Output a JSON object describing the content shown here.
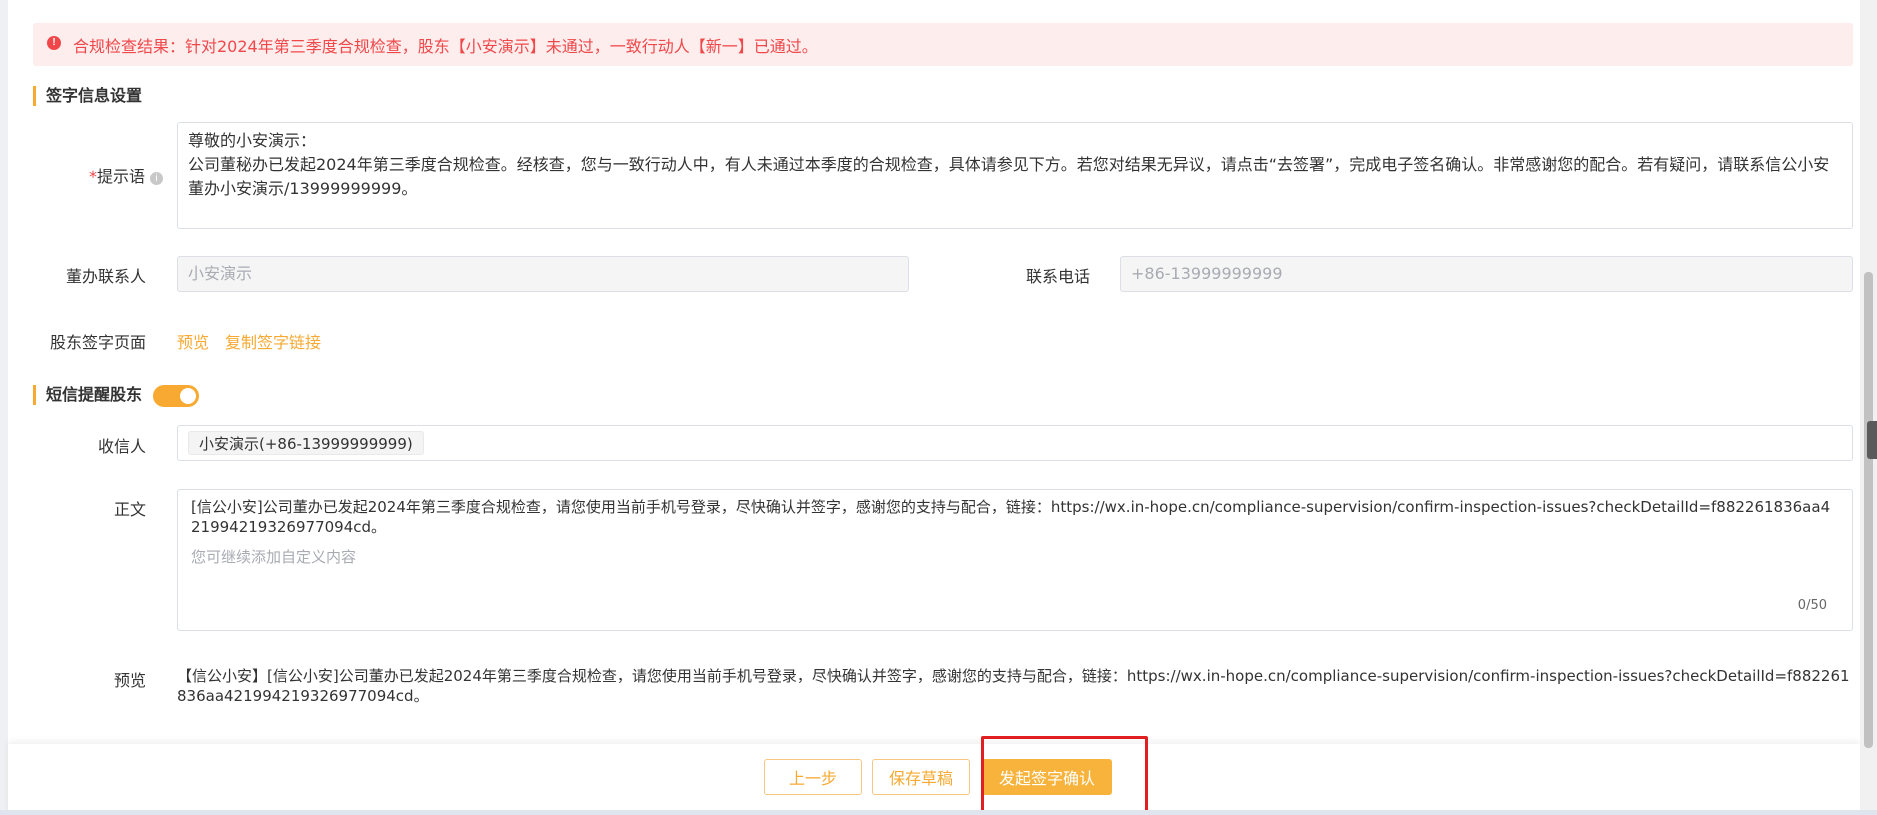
{
  "alert": {
    "icon": "alert-circle-icon",
    "text": "合规检查结果：针对2024年第三季度合规检查，股东【小安演示】未通过，一致行动人【新一】已通过。"
  },
  "sign_section": {
    "title": "签字信息设置",
    "prompt_required_mark": "*",
    "prompt_label": "提示语",
    "prompt_text_line1": "尊敬的小安演示：",
    "prompt_text_body": "公司董秘办已发起2024年第三季度合规检查。经核查，您与一致行动人中，有人未通过本季度的合规检查，具体请参见下方。若您对结果无异议，请点击“去签署”，完成电子签名确认。非常感谢您的配合。若有疑问，请联系信公小安董办小安演示/13999999999。",
    "contact_label": "董办联系人",
    "contact_placeholder": "小安演示",
    "phone_label": "联系电话",
    "phone_placeholder": "+86-13999999999",
    "sign_page_label": "股东签字页面",
    "preview_link": "预览",
    "copy_link": "复制签字链接"
  },
  "sms_section": {
    "title": "短信提醒股东",
    "toggle_on": true,
    "recipient_label": "收信人",
    "recipient_tag": "小安演示(+86-13999999999)",
    "body_label": "正文",
    "body_text": "[信公小安]公司董办已发起2024年第三季度合规检查，请您使用当前手机号登录，尽快确认并签字，感谢您的支持与配合，链接：https://wx.in-hope.cn/compliance-supervision/confirm-inspection-issues?checkDetailId=f882261836aa421994219326977094cd。",
    "custom_placeholder": "您可继续添加自定义内容",
    "counter": "0/50",
    "preview_label": "预览",
    "preview_text": "【信公小安】[信公小安]公司董办已发起2024年第三季度合规检查，请您使用当前手机号登录，尽快确认并签字，感谢您的支持与配合，链接：https://wx.in-hope.cn/compliance-supervision/confirm-inspection-issues?checkDetailId=f882261836aa421994219326977094cd。"
  },
  "footer": {
    "prev_button": "上一步",
    "save_draft_button": "保存草稿",
    "submit_button": "发起签字确认"
  },
  "colors": {
    "accent": "#f7a931",
    "error": "#f0484a",
    "alert_bg": "#fdeded",
    "highlight": "#e02020"
  }
}
